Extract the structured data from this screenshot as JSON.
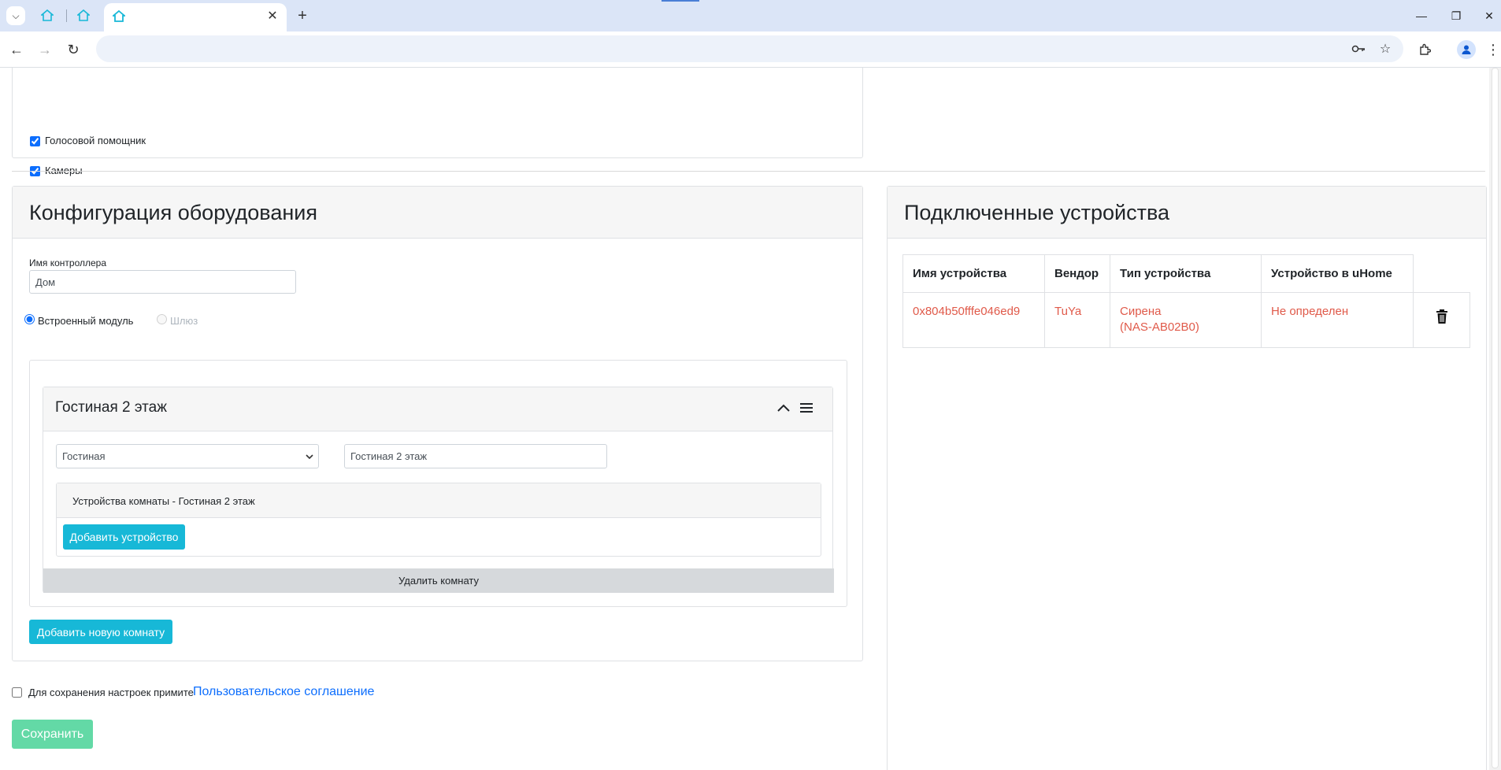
{
  "browser": {
    "tabs": [
      {
        "label": ""
      },
      {
        "label": ""
      },
      {
        "label": ""
      }
    ],
    "address": ""
  },
  "services": {
    "voice_assistant": "Голосовой помощник",
    "cameras": "Камеры"
  },
  "hardware": {
    "title": "Конфигурация оборудования",
    "controller_name_label": "Имя контроллера",
    "controller_name_value": "Дом",
    "radio_builtin": "Встроенный модуль",
    "radio_gateway": "Шлюз",
    "room": {
      "title": "Гостиная 2 этаж",
      "type_selected": "Гостиная",
      "name_value": "Гостиная 2 этаж",
      "devices_header": "Устройства комнаты - Гостиная 2 этаж",
      "add_device": "Добавить устройство",
      "delete_room": "Удалить комнату"
    },
    "add_room": "Добавить новую комнату"
  },
  "agreement": {
    "text": "Для сохранения настроек примите",
    "link": "Пользовательское соглашение"
  },
  "save_label": "Сохранить",
  "devices": {
    "title": "Подключенные устройства",
    "columns": [
      "Имя устройства",
      "Вендор",
      "Тип устройства",
      "Устройство в uHome"
    ],
    "rows": [
      {
        "name": "0x804b50fffe046ed9",
        "vendor": "TuYa",
        "type_line1": "Сирена",
        "type_line2": "(NAS-AB02B0)",
        "uhome": "Не определен"
      }
    ]
  },
  "colors": {
    "accent_info": "#17b8d7",
    "link": "#0d6efd",
    "error_text": "#e05a4a",
    "save_button": "#63d9a6"
  }
}
